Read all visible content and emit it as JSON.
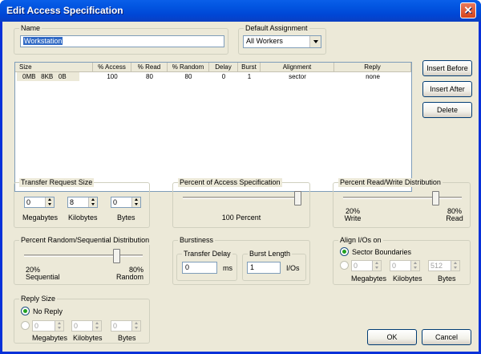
{
  "window": {
    "title": "Edit Access Specification",
    "close_glyph": "✕"
  },
  "name_group": {
    "legend": "Name",
    "value": "Workstation"
  },
  "default_assignment": {
    "legend": "Default Assignment",
    "selected": "All Workers"
  },
  "table": {
    "headers": [
      "Size",
      "% Access",
      "% Read",
      "% Random",
      "Delay",
      "Burst",
      "Alignment",
      "Reply"
    ],
    "rows": [
      {
        "size": "0MB   8KB   0B",
        "access": "100",
        "read": "80",
        "random": "80",
        "delay": "0",
        "burst": "1",
        "alignment": "sector",
        "reply": "none"
      }
    ]
  },
  "side_buttons": {
    "insert_before": "Insert Before",
    "insert_after": "Insert After",
    "delete": "Delete"
  },
  "transfer_request_size": {
    "legend": "Transfer Request Size",
    "megabytes": {
      "value": "0",
      "label": "Megabytes"
    },
    "kilobytes": {
      "value": "8",
      "label": "Kilobytes"
    },
    "bytes": {
      "value": "0",
      "label": "Bytes"
    }
  },
  "percent_access": {
    "legend": "Percent of Access Specification",
    "value": 100,
    "caption": "100 Percent"
  },
  "read_write": {
    "legend": "Percent Read/Write Distribution",
    "value": 80,
    "left_pct": "20%",
    "left_label": "Write",
    "right_pct": "80%",
    "right_label": "Read"
  },
  "random_sequential": {
    "legend": "Percent Random/Sequential Distribution",
    "value": 80,
    "left_pct": "20%",
    "left_label": "Sequential",
    "right_pct": "80%",
    "right_label": "Random"
  },
  "burstiness": {
    "legend": "Burstiness",
    "transfer_delay": {
      "legend": "Transfer Delay",
      "value": "0",
      "unit": "ms"
    },
    "burst_length": {
      "legend": "Burst Length",
      "value": "1",
      "unit": "I/Os"
    }
  },
  "align": {
    "legend": "Align I/Os on",
    "sector_label": "Sector Boundaries",
    "megabytes": {
      "value": "0",
      "label": "Megabytes"
    },
    "kilobytes": {
      "value": "0",
      "label": "Kilobytes"
    },
    "bytes": {
      "value": "512",
      "label": "Bytes"
    }
  },
  "reply_size": {
    "legend": "Reply Size",
    "no_reply_label": "No Reply",
    "megabytes": {
      "value": "0",
      "label": "Megabytes"
    },
    "kilobytes": {
      "value": "0",
      "label": "Kilobytes"
    },
    "bytes": {
      "value": "0",
      "label": "Bytes"
    }
  },
  "footer": {
    "ok": "OK",
    "cancel": "Cancel"
  }
}
